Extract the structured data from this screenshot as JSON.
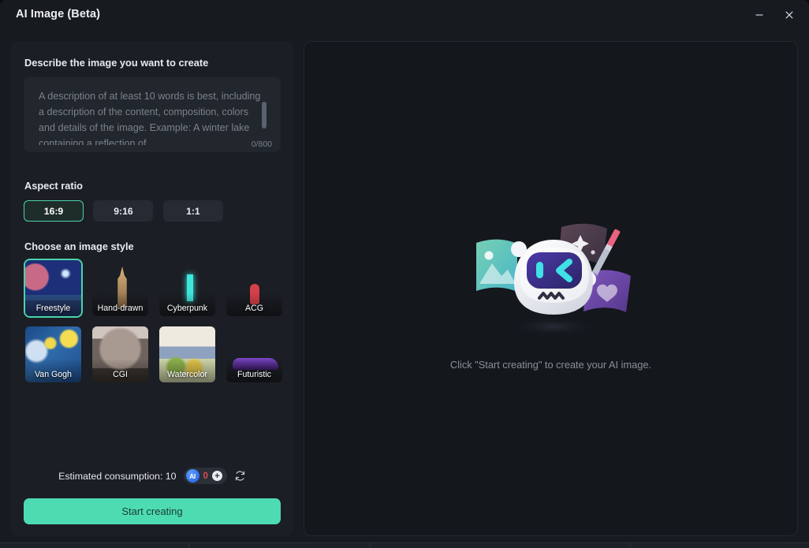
{
  "window": {
    "title": "AI Image (Beta)",
    "controls": [
      {
        "name": "minimize",
        "glyph": "—"
      },
      {
        "name": "close",
        "glyph": "✕"
      }
    ]
  },
  "sidebar": {
    "describe_label": "Describe the image you want to create",
    "prompt": {
      "value": "",
      "placeholder": "A description of at least 10 words is best, including a description of the content, composition, colors and details of the image. Example: A winter lake containing a reflection of",
      "counter": "0/800",
      "max_length": 800
    },
    "aspect_label": "Aspect ratio",
    "aspect_options": [
      {
        "label": "16:9",
        "selected": true
      },
      {
        "label": "9:16",
        "selected": false
      },
      {
        "label": "1:1",
        "selected": false
      }
    ],
    "style_label": "Choose an image style",
    "styles": [
      {
        "label": "Freestyle",
        "selected": true,
        "art": "art-freestyle"
      },
      {
        "label": "Hand-drawn",
        "selected": false,
        "art": "art-hand"
      },
      {
        "label": "Cyberpunk",
        "selected": false,
        "art": "art-cyber"
      },
      {
        "label": "ACG",
        "selected": false,
        "art": "art-acg"
      },
      {
        "label": "Van Gogh",
        "selected": false,
        "art": "art-vangogh"
      },
      {
        "label": "CGI",
        "selected": false,
        "art": "art-cgi"
      },
      {
        "label": "Watercolor",
        "selected": false,
        "art": "art-water"
      },
      {
        "label": "Futuristic",
        "selected": false,
        "art": "art-future"
      }
    ],
    "footer": {
      "consumption_text": "Estimated consumption: 10",
      "credit_icon_label": "AI",
      "credit_count": "0",
      "add_credit_glyph": "+",
      "refresh_icon": "refresh-icon"
    },
    "start_button": "Start creating"
  },
  "preview": {
    "empty_text": "Click \"Start creating\" to create your AI image.",
    "illustration": "ai-robot-mascot"
  },
  "colors": {
    "accent_green": "#4ddcb1",
    "selected_border": "#4ad3ac",
    "panel_bg": "#1b1e24",
    "preview_bg": "#14171c",
    "credit_red": "#d94f4f",
    "ai_blue": "#1d5fe0"
  }
}
